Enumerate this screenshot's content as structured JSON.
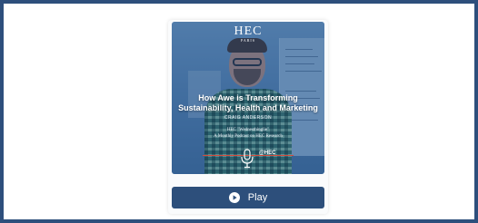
{
  "podcast_card": {
    "logo_text": "HEC",
    "logo_subtext": "PARIS",
    "episode_title": "How Awe is Transforming Sustainability, Health and Marketing",
    "author": "CRAIG ANDERSON",
    "series_line1": "HEC \"Wednesthinglie\"",
    "series_line2": "A Monthly Podcast on HEC Research",
    "badge_text": "@HEC",
    "play_label": "Play",
    "play_icon": "play-circle-icon"
  },
  "colors": {
    "frame_border": "#2e4f7c",
    "button_bg": "#2d4f7b",
    "accent_line": "#d24c3c"
  }
}
